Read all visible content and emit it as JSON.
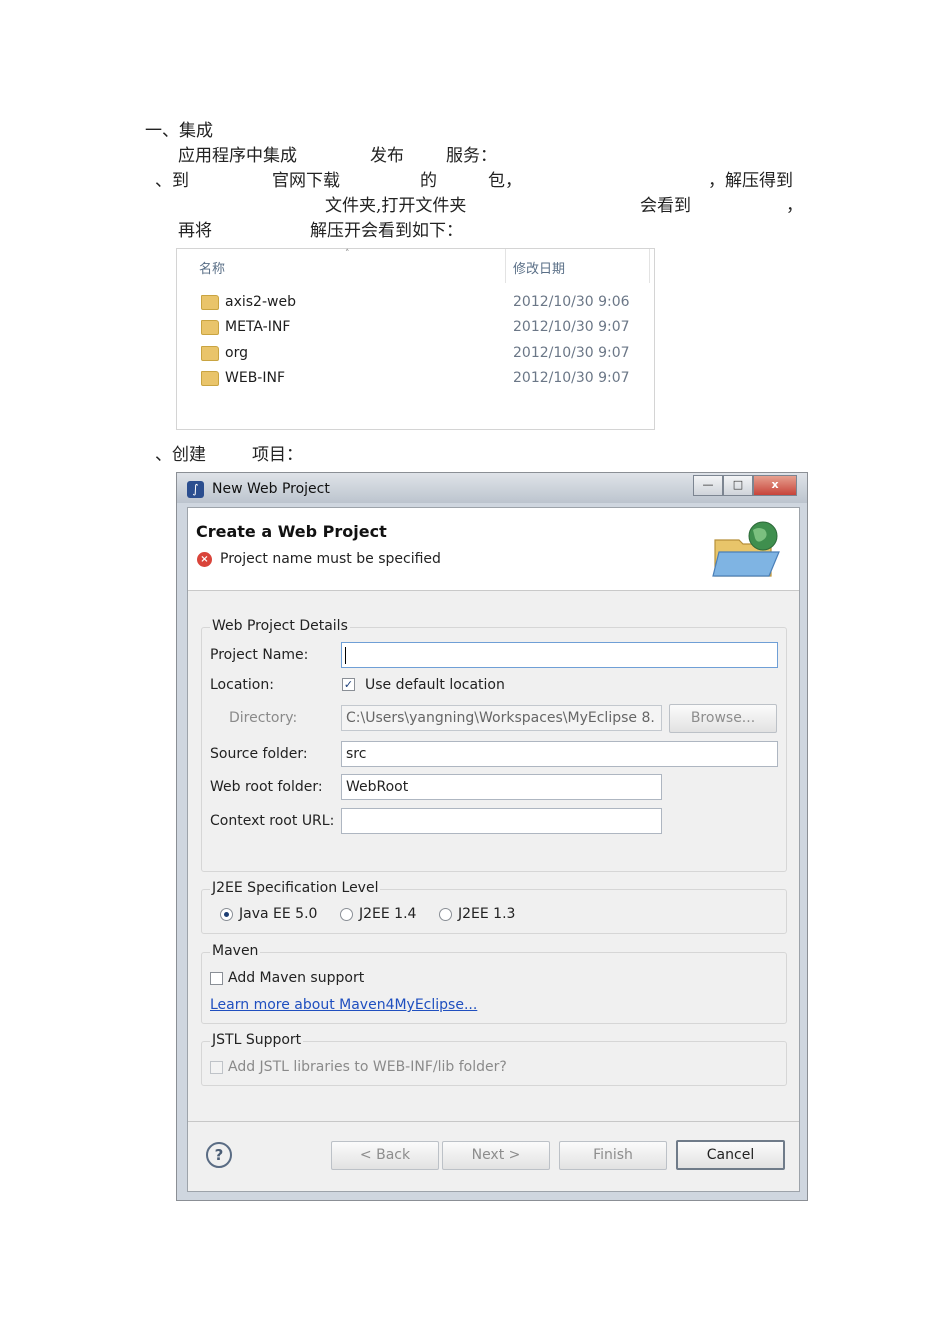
{
  "doc": {
    "line1": "一、集成",
    "line2": "应用程序中集成",
    "line2b": "发布",
    "line2c": "服务：",
    "line3a": "、到",
    "line3b": "官网下载",
    "line3c": "的",
    "line3d": "包，",
    "line3e": "，解压得到",
    "line4a": "文件夹,打开文件夹",
    "line4b": "会看到",
    "line4c": "，",
    "line5a": "再将",
    "line5b": "解压开会看到如下：",
    "line6a": "、创建",
    "line6b": "项目："
  },
  "explorer": {
    "col_name": "名称",
    "col_date": "修改日期",
    "sort_glyph": "˄",
    "rows": [
      {
        "name": "axis2-web",
        "date": "2012/10/30 9:06"
      },
      {
        "name": "META-INF",
        "date": "2012/10/30 9:07"
      },
      {
        "name": "org",
        "date": "2012/10/30 9:07"
      },
      {
        "name": "WEB-INF",
        "date": "2012/10/30 9:07"
      }
    ]
  },
  "dialog": {
    "window_title": "New Web Project",
    "min_glyph": "—",
    "max_glyph": "□",
    "close_glyph": "x",
    "banner_title": "Create a Web Project",
    "error_icon_glyph": "×",
    "error_message": "Project name must be specified",
    "details": {
      "group_title": "Web Project Details",
      "project_name_label": "Project Name:",
      "project_name_value": "",
      "location_label": "Location:",
      "use_default_label": "Use default location",
      "use_default_checked": true,
      "checkmark": "✓",
      "directory_label": "Directory:",
      "directory_value": "C:\\Users\\yangning\\Workspaces\\MyEclipse 8.",
      "browse_label": "Browse...",
      "source_folder_label": "Source folder:",
      "source_folder_value": "src",
      "web_root_label": "Web root folder:",
      "web_root_value": "WebRoot",
      "context_root_label": "Context root URL:",
      "context_root_value": ""
    },
    "j2ee": {
      "group_title": "J2EE Specification Level",
      "options": [
        "Java EE 5.0",
        "J2EE 1.4",
        "J2EE 1.3"
      ],
      "selected": "Java EE 5.0"
    },
    "maven": {
      "group_title": "Maven",
      "add_label": "Add Maven support",
      "link": "Learn more about Maven4MyEclipse..."
    },
    "jstl": {
      "group_title": "JSTL Support",
      "add_label": "Add JSTL libraries to WEB-INF/lib folder?"
    },
    "help_glyph": "?",
    "buttons": {
      "back": "< Back",
      "next": "Next >",
      "finish": "Finish",
      "cancel": "Cancel"
    }
  }
}
